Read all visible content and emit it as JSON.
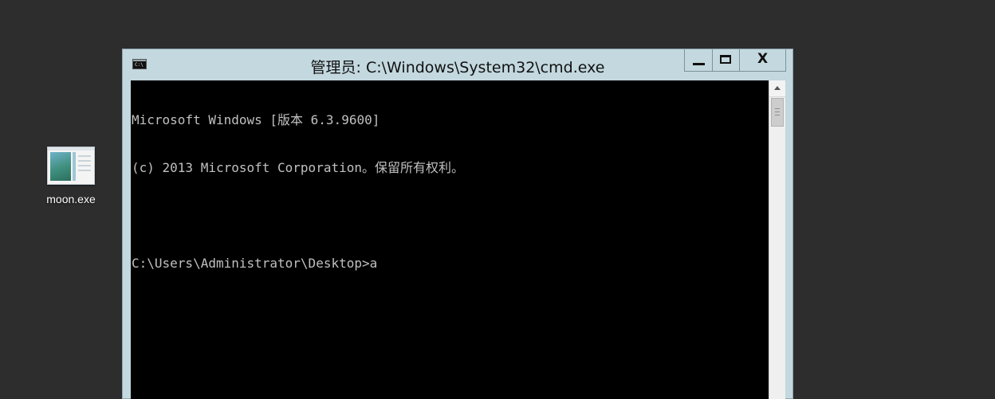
{
  "desktop": {
    "background_color": "#2d2d2d",
    "icons": [
      {
        "label": "moon.exe",
        "icon": "application-window-icon"
      }
    ]
  },
  "window": {
    "title": "管理员: C:\\Windows\\System32\\cmd.exe",
    "app_icon": "command-prompt-icon",
    "app_icon_text": "C:\\",
    "controls": {
      "minimize": "minimize-icon",
      "maximize": "maximize-icon",
      "close": "close-icon",
      "close_glyph": "X"
    },
    "frame_color": "#c3d8df"
  },
  "console": {
    "background_color": "#000000",
    "text_color": "#c0c0c0",
    "lines": [
      "Microsoft Windows [版本 6.3.9600]",
      "(c) 2013 Microsoft Corporation。保留所有权利。",
      "",
      "C:\\Users\\Administrator\\Desktop>a"
    ]
  }
}
